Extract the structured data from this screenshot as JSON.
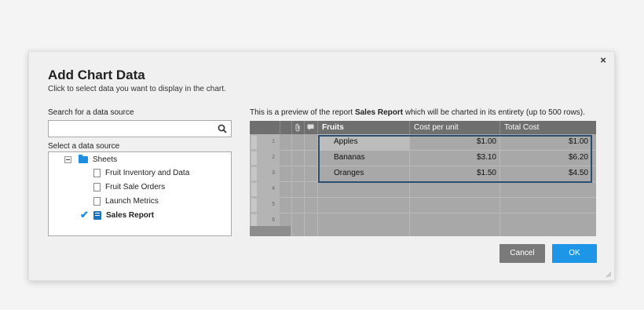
{
  "dialog": {
    "title": "Add Chart Data",
    "subtitle": "Click to select data you want to display in the chart.",
    "close_symbol": "×"
  },
  "search": {
    "label": "Search for a data source",
    "value": "",
    "placeholder": ""
  },
  "source": {
    "label": "Select a data source",
    "tree": {
      "root_label": "Sheets",
      "items": [
        {
          "label": "Fruit Inventory and Data",
          "icon": "sheet-icon"
        },
        {
          "label": "Fruit Sale Orders",
          "icon": "sheet-icon"
        },
        {
          "label": "Launch Metrics",
          "icon": "sheet-icon"
        },
        {
          "label": "Sales Report",
          "icon": "report-icon",
          "selected": true
        }
      ]
    }
  },
  "preview": {
    "prefix": "This is a preview of the report ",
    "report_name": "Sales Report",
    "suffix": " which will be charted in its entirety (up to 500 rows).",
    "columns": [
      "Fruits",
      "Cost per unit",
      "Total Cost"
    ],
    "rows": [
      {
        "num": "1",
        "cells": [
          "Apples",
          "$1.00",
          "$1.00"
        ]
      },
      {
        "num": "2",
        "cells": [
          "Bananas",
          "$3.10",
          "$6.20"
        ]
      },
      {
        "num": "3",
        "cells": [
          "Oranges",
          "$1.50",
          "$4.50"
        ]
      },
      {
        "num": "4",
        "cells": [
          "",
          "",
          ""
        ]
      },
      {
        "num": "5",
        "cells": [
          "",
          "",
          ""
        ]
      },
      {
        "num": "6",
        "cells": [
          "",
          "",
          ""
        ]
      }
    ]
  },
  "buttons": {
    "cancel": "Cancel",
    "ok": "OK"
  },
  "colors": {
    "accent": "#1e96e8",
    "grid_header": "#6f6f6f",
    "selection_border": "#2d4f6f"
  }
}
